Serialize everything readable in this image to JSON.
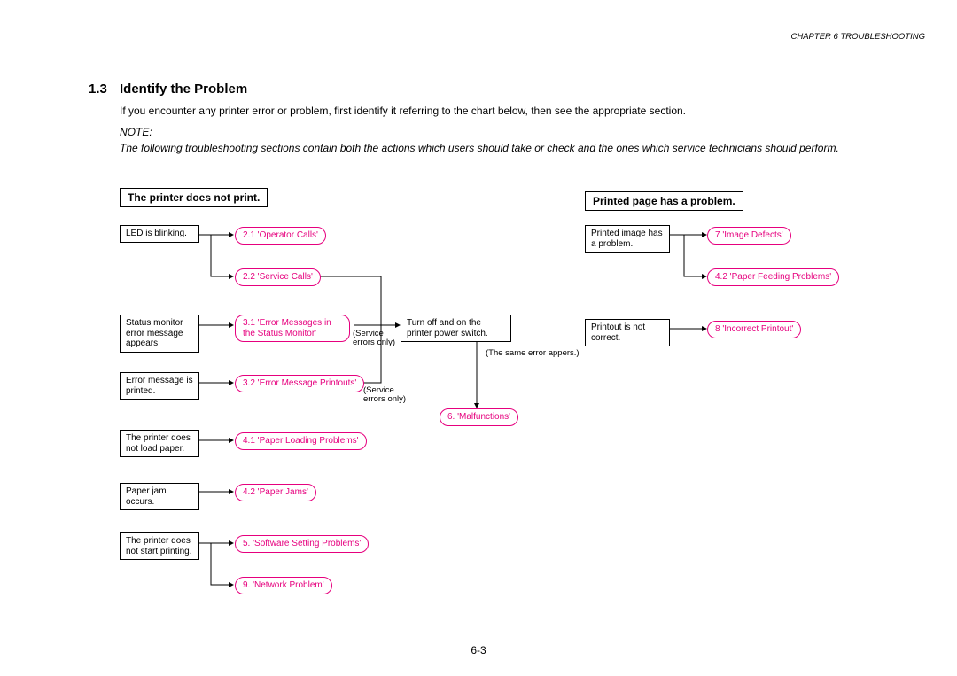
{
  "header": {
    "chapter": "CHAPTER 6  TROUBLESHOOTING"
  },
  "section": {
    "num": "1.3",
    "title": "Identify the Problem"
  },
  "intro": "If you encounter any printer error or problem, first identify it referring to the chart below, then see the appropriate section.",
  "note": {
    "label": "NOTE:",
    "body": "The following troubleshooting sections contain both the actions which users should take or check and the ones which service technicians should perform."
  },
  "left": {
    "header": "The printer does not print.",
    "sym": {
      "led": "LED is blinking.",
      "status": "Status monitor error message appears.",
      "errmsg": "Error message is printed.",
      "noload": "The printer does not load paper.",
      "jam": "Paper jam occurs.",
      "nostart": "The printer does not start printing."
    },
    "act": {
      "op": "2.1 'Operator Calls'",
      "svc": "2.2 'Service Calls'",
      "errmon": "3.1 'Error Messages in the Status Monitor'",
      "errprn": "3.2 'Error Message Printouts'",
      "loadp": "4.1 'Paper Loading Problems'",
      "jam": "4.2 'Paper Jams'",
      "soft": "5. 'Software Setting Problems'",
      "net": "9. 'Network Problem'",
      "toggle": "Turn off and on the printer power switch.",
      "malf": "6. 'Malfunctions'",
      "serv_only1": "(Service errors only)",
      "serv_only2": "(Service errors only)",
      "same": "(The same error appers.)"
    }
  },
  "right": {
    "header": "Printed page has a problem.",
    "sym": {
      "img": "Printed image has a problem.",
      "inc": "Printout is not correct."
    },
    "act": {
      "imgd": "7 'Image Defects'",
      "feed": "4.2 'Paper Feeding Problems'",
      "inc": "8 'Incorrect Printout'"
    }
  },
  "page": "6-3"
}
